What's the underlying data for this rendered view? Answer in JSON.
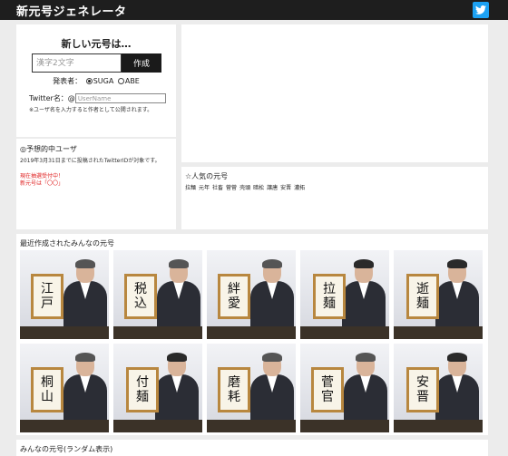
{
  "header": {
    "title": "新元号ジェネレータ",
    "twitter_icon": "twitter-icon"
  },
  "generator": {
    "heading": "新しい元号は…",
    "input_placeholder": "漢字2文字",
    "submit_label": "作成",
    "presenter_label": "発表者：",
    "presenters": [
      {
        "label": "SUGA",
        "checked": true
      },
      {
        "label": "ABE",
        "checked": false
      }
    ],
    "twitter_label": "Twitter名：@",
    "username_placeholder": "UserName",
    "note": "※ユーザ名を入力すると作者として公開されます。"
  },
  "expect": {
    "heading": "◎予想的中ユーザ",
    "note": "2019年3月31日までに投稿されたTwitterIDが対象です。",
    "status_line1": "現在抽選受付中！",
    "status_line2": "新元号は「〇〇」"
  },
  "popular": {
    "heading": "☆人気の元号",
    "items": [
      "拉麺",
      "元年",
      "社畜",
      "菅菅",
      "壳頭",
      "暗松",
      "譲唐",
      "安晋",
      "濃拓"
    ]
  },
  "recent": {
    "heading": "最近作成されたみんなの元号",
    "items": [
      {
        "era": [
          "江",
          "戸"
        ],
        "presenter": "SUGA"
      },
      {
        "era": [
          "税",
          "込"
        ],
        "presenter": "SUGA"
      },
      {
        "era": [
          "絆",
          "愛"
        ],
        "presenter": "SUGA"
      },
      {
        "era": [
          "拉",
          "麺"
        ],
        "presenter": "ABE"
      },
      {
        "era": [
          "逝",
          "麺"
        ],
        "presenter": "ABE"
      },
      {
        "era": [
          "桐",
          "山"
        ],
        "presenter": "SUGA"
      },
      {
        "era": [
          "付",
          "麺"
        ],
        "presenter": "ABE"
      },
      {
        "era": [
          "磨",
          "耗"
        ],
        "presenter": "SUGA"
      },
      {
        "era": [
          "菅",
          "官"
        ],
        "presenter": "SUGA"
      },
      {
        "era": [
          "安",
          "晋"
        ],
        "presenter": "ABE"
      }
    ]
  },
  "random": {
    "heading": "みんなの元号(ランダム表示)"
  }
}
